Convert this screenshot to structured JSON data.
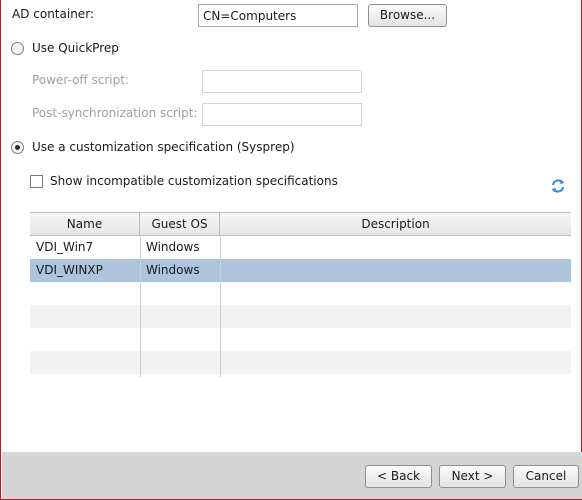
{
  "ad_container": {
    "label": "AD container:",
    "value": "CN=Computers",
    "browse_label": "Browse..."
  },
  "quickprep": {
    "label": "Use QuickPrep",
    "selected": false,
    "power_off_label": "Power-off script:",
    "power_off_value": "",
    "post_sync_label": "Post-synchronization script:",
    "post_sync_value": ""
  },
  "sysprep": {
    "label": "Use a customization specification (Sysprep)",
    "selected": true,
    "show_incompatible_label": "Show incompatible customization specifications",
    "show_incompatible_checked": false,
    "refresh_icon": "refresh-icon"
  },
  "table": {
    "columns": [
      "Name",
      "Guest OS",
      "Description"
    ],
    "rows": [
      {
        "name": "VDI_Win7",
        "guest_os": "Windows",
        "description": ""
      },
      {
        "name": "VDI_WINXP",
        "guest_os": "Windows",
        "description": "",
        "selected": true
      }
    ],
    "selected_color": "#aec4dc"
  },
  "footer": {
    "back_label": "< Back",
    "next_label": "Next >",
    "cancel_label": "Cancel"
  },
  "colors": {
    "border_accent": "#c8141e",
    "footer_bg": "#d5d5d5",
    "disabled_text": "#a0a0a0"
  }
}
